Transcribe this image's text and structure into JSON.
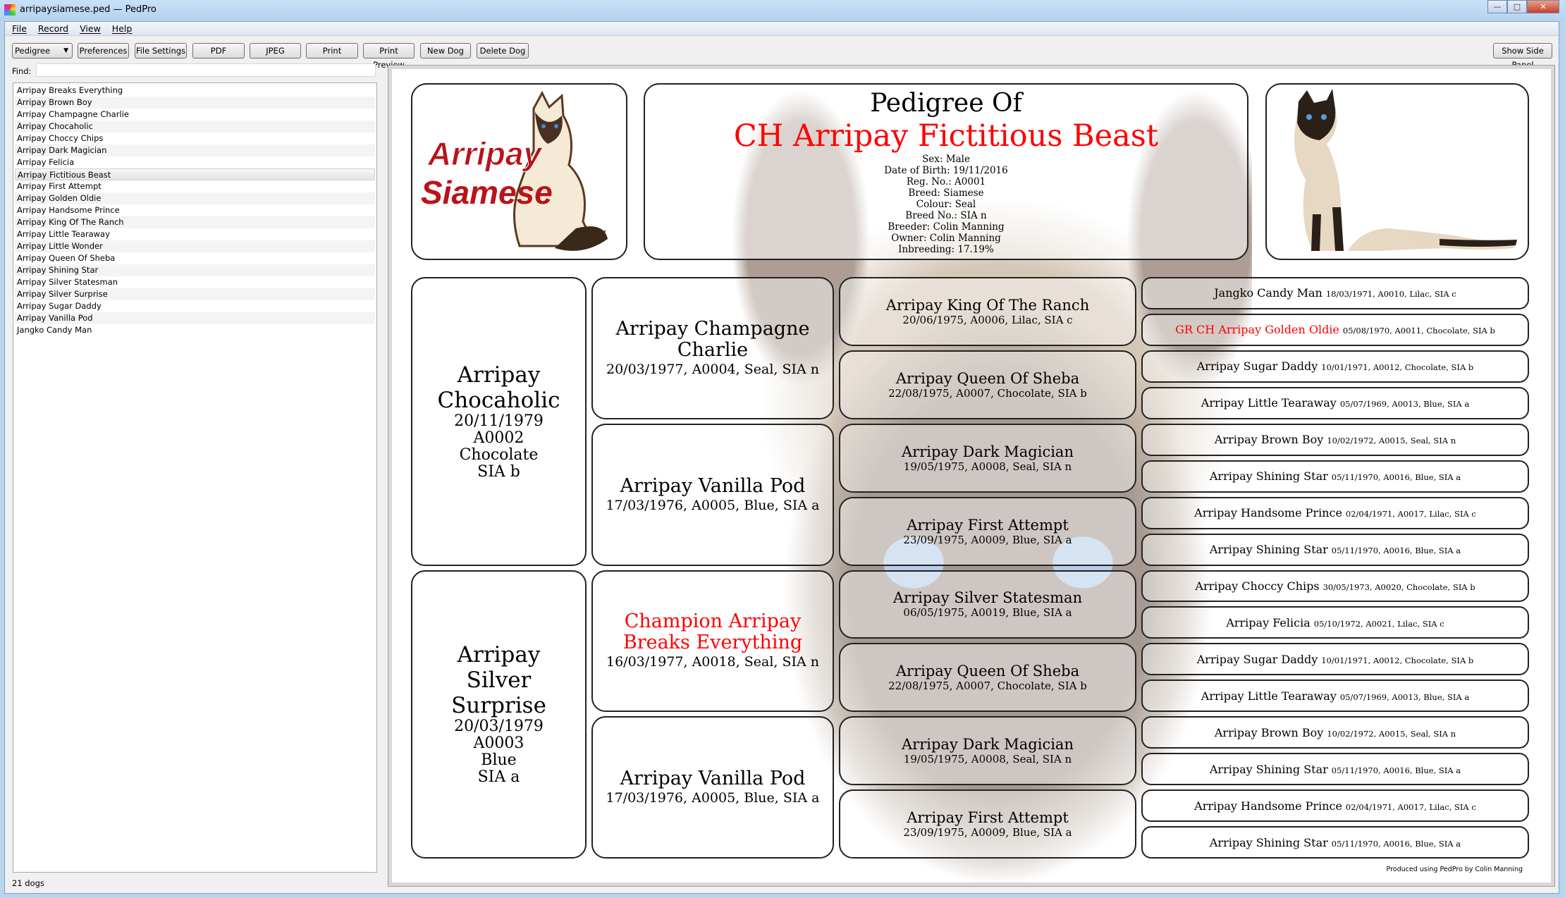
{
  "window": {
    "title": "arripaysiamese.ped — PedPro",
    "minimize": "—",
    "maximize": "□",
    "close": "✕"
  },
  "menu": [
    "File",
    "Record",
    "View",
    "Help"
  ],
  "toolbar": {
    "view_select": "Pedigree",
    "preferences": "Preferences",
    "file_settings": "File Settings",
    "pdf": "PDF",
    "jpeg": "JPEG",
    "print": "Print",
    "print_preview": "Print Preview",
    "new_dog": "New Dog",
    "delete_dog": "Delete Dog",
    "show_side_panel": "Show Side Panel"
  },
  "find": {
    "label": "Find:",
    "value": ""
  },
  "dog_list": {
    "selected": "Arripay Fictitious Beast",
    "items": [
      "Arripay Breaks Everything",
      "Arripay Brown Boy",
      "Arripay Champagne Charlie",
      "Arripay Chocaholic",
      "Arripay Choccy Chips",
      "Arripay Dark Magician",
      "Arripay Felicia",
      "Arripay Fictitious Beast",
      "Arripay First Attempt",
      "Arripay Golden Oldie",
      "Arripay Handsome Prince",
      "Arripay King Of The Ranch",
      "Arripay Little Tearaway",
      "Arripay Little Wonder",
      "Arripay Queen Of Sheba",
      "Arripay Shining Star",
      "Arripay Silver Statesman",
      "Arripay Silver Surprise",
      "Arripay Sugar Daddy",
      "Arripay Vanilla Pod",
      "Jangko Candy Man"
    ]
  },
  "status": "21 dogs",
  "colors": {
    "title_red": "#ff0000"
  },
  "logo": {
    "text_line1": "Arripay",
    "text_line2": "Siamese"
  },
  "header": {
    "title": "Pedigree Of",
    "name": "CH Arripay Fictitious Beast",
    "details": [
      "Sex: Male",
      "Date of Birth: 19/11/2016",
      "Reg. No.: A0001",
      "Breed: Siamese",
      "Colour: Seal",
      "Breed No.: SIA n",
      "Breeder: Colin Manning",
      "Owner: Colin Manning",
      "Inbreeding: 17.19%"
    ]
  },
  "gen1": [
    {
      "name": "Arripay Chocaholic",
      "lines": [
        "20/11/1979",
        "A0002",
        "Chocolate",
        "SIA b"
      ]
    },
    {
      "name": "Arripay Silver Surprise",
      "lines": [
        "20/03/1979",
        "A0003",
        "Blue",
        "SIA a"
      ]
    }
  ],
  "gen2": [
    {
      "name": "Arripay Champagne Charlie",
      "details": "20/03/1977, A0004, Seal, SIA n"
    },
    {
      "name": "Arripay Vanilla Pod",
      "details": "17/03/1976, A0005, Blue, SIA a"
    },
    {
      "name": "Champion Arripay Breaks Everything",
      "details": "16/03/1977, A0018, Seal, SIA n",
      "titled": true
    },
    {
      "name": "Arripay Vanilla Pod",
      "details": "17/03/1976, A0005, Blue, SIA a"
    }
  ],
  "gen3": [
    {
      "name": "Arripay King Of The Ranch",
      "details": "20/06/1975, A0006, Lilac, SIA c"
    },
    {
      "name": "Arripay Queen Of Sheba",
      "details": "22/08/1975, A0007, Chocolate, SIA b"
    },
    {
      "name": "Arripay Dark Magician",
      "details": "19/05/1975, A0008, Seal, SIA n"
    },
    {
      "name": "Arripay First Attempt",
      "details": "23/09/1975, A0009, Blue, SIA a"
    },
    {
      "name": "Arripay Silver Statesman",
      "details": "06/05/1975, A0019, Blue, SIA a"
    },
    {
      "name": "Arripay Queen Of Sheba",
      "details": "22/08/1975, A0007, Chocolate, SIA b"
    },
    {
      "name": "Arripay Dark Magician",
      "details": "19/05/1975, A0008, Seal, SIA n"
    },
    {
      "name": "Arripay First Attempt",
      "details": "23/09/1975, A0009, Blue, SIA a"
    }
  ],
  "gen4": [
    {
      "name": "Jangko Candy Man",
      "details": "18/03/1971, A0010, Lilac, SIA c"
    },
    {
      "name": "GR CH Arripay Golden Oldie",
      "details": "05/08/1970, A0011, Chocolate, SIA b",
      "titled": true
    },
    {
      "name": "Arripay Sugar Daddy",
      "details": "10/01/1971, A0012, Chocolate, SIA b"
    },
    {
      "name": "Arripay Little Tearaway",
      "details": "05/07/1969, A0013, Blue, SIA a"
    },
    {
      "name": "Arripay Brown Boy",
      "details": "10/02/1972, A0015, Seal, SIA n"
    },
    {
      "name": "Arripay Shining Star",
      "details": "05/11/1970, A0016, Blue, SIA a"
    },
    {
      "name": "Arripay Handsome Prince",
      "details": "02/04/1971, A0017, Lilac, SIA c"
    },
    {
      "name": "Arripay Shining Star",
      "details": "05/11/1970, A0016, Blue, SIA a"
    },
    {
      "name": "Arripay Choccy Chips",
      "details": "30/05/1973, A0020, Chocolate, SIA b"
    },
    {
      "name": "Arripay Felicia",
      "details": "05/10/1972, A0021, Lilac, SIA c"
    },
    {
      "name": "Arripay Sugar Daddy",
      "details": "10/01/1971, A0012, Chocolate, SIA b"
    },
    {
      "name": "Arripay Little Tearaway",
      "details": "05/07/1969, A0013, Blue, SIA a"
    },
    {
      "name": "Arripay Brown Boy",
      "details": "10/02/1972, A0015, Seal, SIA n"
    },
    {
      "name": "Arripay Shining Star",
      "details": "05/11/1970, A0016, Blue, SIA a"
    },
    {
      "name": "Arripay Handsome Prince",
      "details": "02/04/1971, A0017, Lilac, SIA c"
    },
    {
      "name": "Arripay Shining Star",
      "details": "05/11/1970, A0016, Blue, SIA a"
    }
  ],
  "footer": "Produced using PedPro by Colin Manning"
}
